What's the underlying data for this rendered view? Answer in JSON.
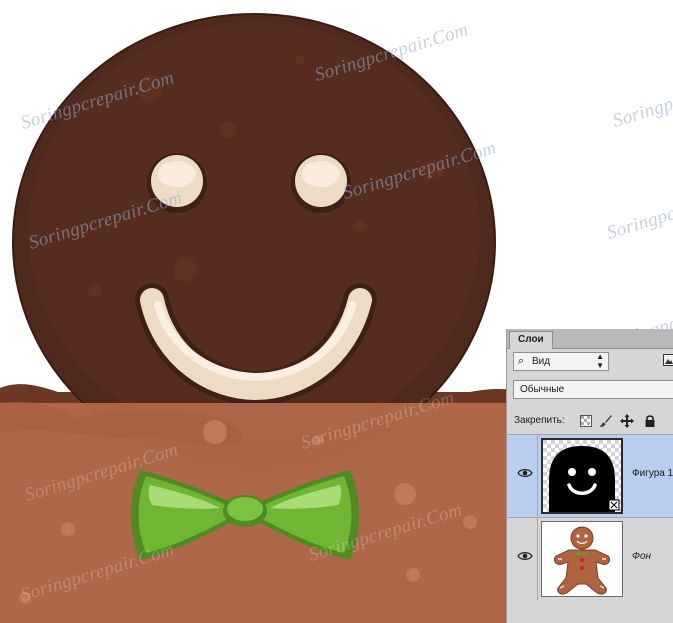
{
  "watermark": "Soringpcrepair.Com",
  "panel": {
    "tab": "Слои",
    "filter_value": "Вид",
    "blend_mode": "Обычные",
    "lock_label": "Закрепить:",
    "layers": [
      {
        "name": "Фигура 1",
        "selected": true,
        "visible": true
      },
      {
        "name": "Фон",
        "selected": false,
        "visible": true
      }
    ]
  },
  "colors": {
    "head": "#4f291d",
    "body": "#b36a4a",
    "bowtie": "#6fb632",
    "icing": "#eddcc5",
    "selection": "#b8cdf0",
    "panel_bg": "#d6d6d6"
  }
}
